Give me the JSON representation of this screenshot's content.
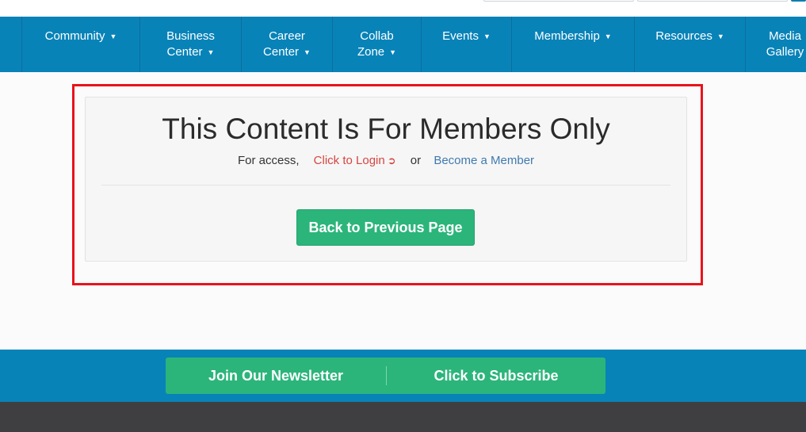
{
  "nav": {
    "items": [
      {
        "lines": [
          "Community"
        ],
        "caret": "▼"
      },
      {
        "lines": [
          "Business",
          "Center"
        ],
        "caret": "▼"
      },
      {
        "lines": [
          "Career",
          "Center"
        ],
        "caret": "▼"
      },
      {
        "lines": [
          "Collab",
          "Zone"
        ],
        "caret": "▼"
      },
      {
        "lines": [
          "Events"
        ],
        "caret": "▼"
      },
      {
        "lines": [
          "Membership"
        ],
        "caret": "▼"
      },
      {
        "lines": [
          "Resources"
        ],
        "caret": "▼"
      },
      {
        "lines": [
          "Media",
          "Gallery"
        ],
        "caret": ""
      }
    ]
  },
  "panel": {
    "title": "This Content Is For Members Only",
    "access_prefix": "For access,",
    "login_label": "Click to Login",
    "login_icon": "➲",
    "or_label": "or",
    "member_label": "Become a Member",
    "back_label": "Back to Previous Page"
  },
  "newsletter": {
    "left_label": "Join Our Newsletter",
    "right_label": "Click to Subscribe"
  },
  "colors": {
    "nav_bg": "#0883b8",
    "accent_green": "#2bb57a",
    "highlight_red": "#e8131b",
    "login_red": "#d64541",
    "member_blue": "#3f7ab0",
    "footer_dark": "#3f3f42"
  }
}
